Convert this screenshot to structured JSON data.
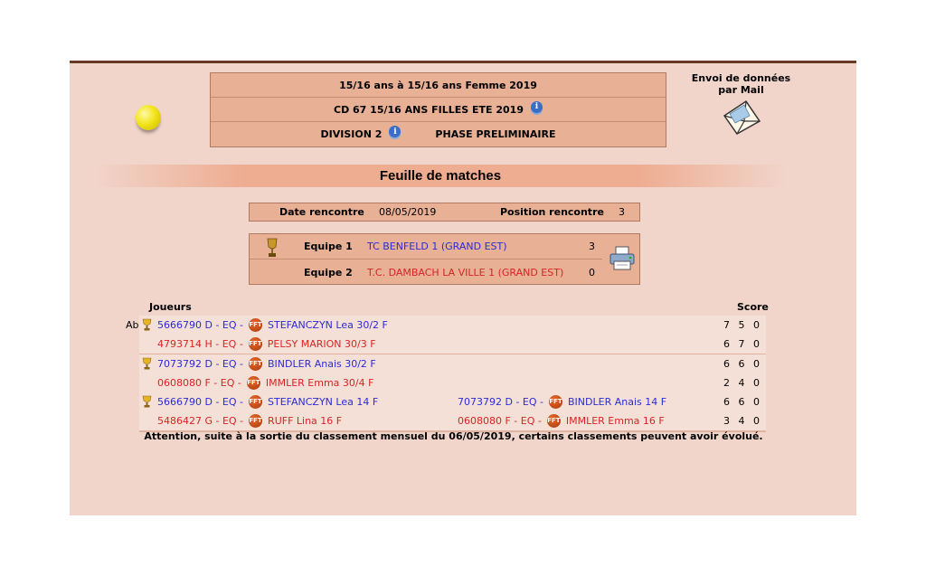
{
  "header": {
    "line1": "15/16 ans  à 15/16 ans  Femme  2019",
    "line2": "CD 67 15/16 ANS FILLES ETE 2019",
    "division": "DIVISION 2",
    "phase": "PHASE PRELIMINAIRE",
    "info_glyph": "i"
  },
  "mail": {
    "label": "Envoi de données par Mail"
  },
  "banner": {
    "title": "Feuille de matches"
  },
  "rencontre": {
    "date_label": "Date rencontre",
    "date_value": "08/05/2019",
    "position_label": "Position rencontre",
    "position_value": "3"
  },
  "teams": [
    {
      "label": "Equipe 1",
      "name": "TC BENFELD 1 (GRAND EST)",
      "score": "3",
      "color": "#2b2bd6"
    },
    {
      "label": "Equipe 2",
      "name": "T.C. DAMBACH LA VILLE 1 (GRAND EST)",
      "score": "0",
      "color": "#d82424"
    }
  ],
  "table": {
    "players_header": "Joueurs",
    "score_header": "Score",
    "ab_label": "Ab"
  },
  "fft_badge": "FFT",
  "matches": [
    {
      "winner_line": 0,
      "lines": [
        {
          "p1": {
            "id": "5666790 D -  EQ -",
            "name": "STEFANCZYN  Lea  30/2 F"
          },
          "score": "7 5 0"
        },
        {
          "p1": {
            "id": "4793714 H -  EQ -",
            "name": "PELSY  MARION 30/3 F"
          },
          "score": "6 7 0"
        }
      ]
    },
    {
      "winner_line": 0,
      "lines": [
        {
          "p1": {
            "id": "7073792 D -  EQ -",
            "name": "BINDLER  Anais  30/2 F"
          },
          "score": "6 6 0"
        },
        {
          "p1": {
            "id": "0608080 F -  EQ -",
            "name": "IMMLER  Emma 30/4 F"
          },
          "score": "2 4 0"
        }
      ]
    },
    {
      "winner_line": 0,
      "lines": [
        {
          "p1": {
            "id": "5666790 D -  EQ -",
            "name": "STEFANCZYN  Lea  14 F"
          },
          "p2": {
            "id": "7073792 D -  EQ -",
            "name": "BINDLER  Anais  14 F"
          },
          "score": "6 6 0"
        },
        {
          "p1": {
            "id": "5486427 G -  EQ -",
            "name": "RUFF  Lina 16 F"
          },
          "p2": {
            "id": "0608080 F -  EQ -",
            "name": "IMMLER  Emma 16 F"
          },
          "score": "3 4 0"
        }
      ]
    }
  ],
  "notice": "Attention, suite à la sortie du classement mensuel du 06/05/2019, certains classements peuvent avoir évolué.",
  "colors": {
    "accent_blue": "#2b2bd6",
    "accent_red": "#d82424",
    "header_bg": "#e8b095",
    "page_bg": "#f1d5cb"
  }
}
